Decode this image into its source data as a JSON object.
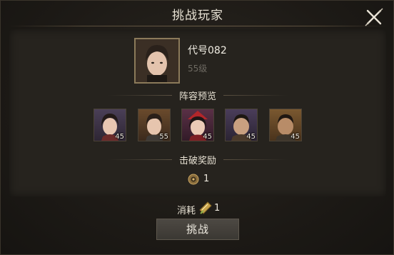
{
  "dialog": {
    "title": "挑战玩家",
    "close_icon": "close-x-icon"
  },
  "player": {
    "name": "代号082",
    "level": "55级",
    "avatar_icon": "player-portrait"
  },
  "lineup": {
    "heading": "阵容预览",
    "heroes": [
      {
        "level": "45",
        "portrait": "female-hero-portrait"
      },
      {
        "level": "55",
        "portrait": "male-hero-portrait"
      },
      {
        "level": "45",
        "portrait": "female-hero-red-headdress-portrait"
      },
      {
        "level": "45",
        "portrait": "male-hero-portrait"
      },
      {
        "level": "45",
        "portrait": "male-hero-portrait"
      }
    ]
  },
  "reward": {
    "heading": "击破奖励",
    "icon": "coin-icon",
    "count": "1"
  },
  "cost": {
    "label": "消耗",
    "icon": "challenge-ticket-icon",
    "count": "1"
  },
  "action": {
    "challenge_label": "挑战"
  }
}
